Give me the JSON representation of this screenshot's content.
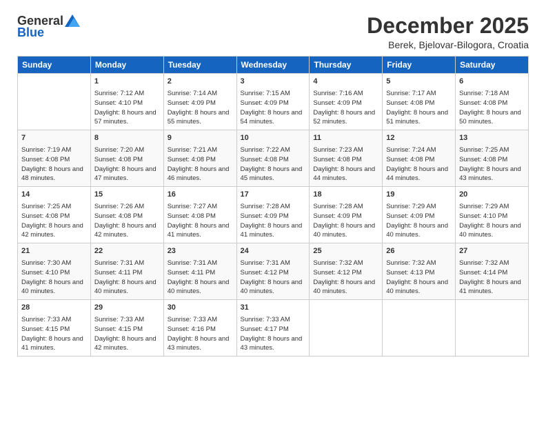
{
  "logo": {
    "general": "General",
    "blue": "Blue"
  },
  "title": "December 2025",
  "location": "Berek, Bjelovar-Bilogora, Croatia",
  "days_of_week": [
    "Sunday",
    "Monday",
    "Tuesday",
    "Wednesday",
    "Thursday",
    "Friday",
    "Saturday"
  ],
  "weeks": [
    [
      {
        "day": "",
        "sunrise": "",
        "sunset": "",
        "daylight": ""
      },
      {
        "day": "1",
        "sunrise": "Sunrise: 7:12 AM",
        "sunset": "Sunset: 4:10 PM",
        "daylight": "Daylight: 8 hours and 57 minutes."
      },
      {
        "day": "2",
        "sunrise": "Sunrise: 7:14 AM",
        "sunset": "Sunset: 4:09 PM",
        "daylight": "Daylight: 8 hours and 55 minutes."
      },
      {
        "day": "3",
        "sunrise": "Sunrise: 7:15 AM",
        "sunset": "Sunset: 4:09 PM",
        "daylight": "Daylight: 8 hours and 54 minutes."
      },
      {
        "day": "4",
        "sunrise": "Sunrise: 7:16 AM",
        "sunset": "Sunset: 4:09 PM",
        "daylight": "Daylight: 8 hours and 52 minutes."
      },
      {
        "day": "5",
        "sunrise": "Sunrise: 7:17 AM",
        "sunset": "Sunset: 4:08 PM",
        "daylight": "Daylight: 8 hours and 51 minutes."
      },
      {
        "day": "6",
        "sunrise": "Sunrise: 7:18 AM",
        "sunset": "Sunset: 4:08 PM",
        "daylight": "Daylight: 8 hours and 50 minutes."
      }
    ],
    [
      {
        "day": "7",
        "sunrise": "Sunrise: 7:19 AM",
        "sunset": "Sunset: 4:08 PM",
        "daylight": "Daylight: 8 hours and 48 minutes."
      },
      {
        "day": "8",
        "sunrise": "Sunrise: 7:20 AM",
        "sunset": "Sunset: 4:08 PM",
        "daylight": "Daylight: 8 hours and 47 minutes."
      },
      {
        "day": "9",
        "sunrise": "Sunrise: 7:21 AM",
        "sunset": "Sunset: 4:08 PM",
        "daylight": "Daylight: 8 hours and 46 minutes."
      },
      {
        "day": "10",
        "sunrise": "Sunrise: 7:22 AM",
        "sunset": "Sunset: 4:08 PM",
        "daylight": "Daylight: 8 hours and 45 minutes."
      },
      {
        "day": "11",
        "sunrise": "Sunrise: 7:23 AM",
        "sunset": "Sunset: 4:08 PM",
        "daylight": "Daylight: 8 hours and 44 minutes."
      },
      {
        "day": "12",
        "sunrise": "Sunrise: 7:24 AM",
        "sunset": "Sunset: 4:08 PM",
        "daylight": "Daylight: 8 hours and 44 minutes."
      },
      {
        "day": "13",
        "sunrise": "Sunrise: 7:25 AM",
        "sunset": "Sunset: 4:08 PM",
        "daylight": "Daylight: 8 hours and 43 minutes."
      }
    ],
    [
      {
        "day": "14",
        "sunrise": "Sunrise: 7:25 AM",
        "sunset": "Sunset: 4:08 PM",
        "daylight": "Daylight: 8 hours and 42 minutes."
      },
      {
        "day": "15",
        "sunrise": "Sunrise: 7:26 AM",
        "sunset": "Sunset: 4:08 PM",
        "daylight": "Daylight: 8 hours and 42 minutes."
      },
      {
        "day": "16",
        "sunrise": "Sunrise: 7:27 AM",
        "sunset": "Sunset: 4:08 PM",
        "daylight": "Daylight: 8 hours and 41 minutes."
      },
      {
        "day": "17",
        "sunrise": "Sunrise: 7:28 AM",
        "sunset": "Sunset: 4:09 PM",
        "daylight": "Daylight: 8 hours and 41 minutes."
      },
      {
        "day": "18",
        "sunrise": "Sunrise: 7:28 AM",
        "sunset": "Sunset: 4:09 PM",
        "daylight": "Daylight: 8 hours and 40 minutes."
      },
      {
        "day": "19",
        "sunrise": "Sunrise: 7:29 AM",
        "sunset": "Sunset: 4:09 PM",
        "daylight": "Daylight: 8 hours and 40 minutes."
      },
      {
        "day": "20",
        "sunrise": "Sunrise: 7:29 AM",
        "sunset": "Sunset: 4:10 PM",
        "daylight": "Daylight: 8 hours and 40 minutes."
      }
    ],
    [
      {
        "day": "21",
        "sunrise": "Sunrise: 7:30 AM",
        "sunset": "Sunset: 4:10 PM",
        "daylight": "Daylight: 8 hours and 40 minutes."
      },
      {
        "day": "22",
        "sunrise": "Sunrise: 7:31 AM",
        "sunset": "Sunset: 4:11 PM",
        "daylight": "Daylight: 8 hours and 40 minutes."
      },
      {
        "day": "23",
        "sunrise": "Sunrise: 7:31 AM",
        "sunset": "Sunset: 4:11 PM",
        "daylight": "Daylight: 8 hours and 40 minutes."
      },
      {
        "day": "24",
        "sunrise": "Sunrise: 7:31 AM",
        "sunset": "Sunset: 4:12 PM",
        "daylight": "Daylight: 8 hours and 40 minutes."
      },
      {
        "day": "25",
        "sunrise": "Sunrise: 7:32 AM",
        "sunset": "Sunset: 4:12 PM",
        "daylight": "Daylight: 8 hours and 40 minutes."
      },
      {
        "day": "26",
        "sunrise": "Sunrise: 7:32 AM",
        "sunset": "Sunset: 4:13 PM",
        "daylight": "Daylight: 8 hours and 40 minutes."
      },
      {
        "day": "27",
        "sunrise": "Sunrise: 7:32 AM",
        "sunset": "Sunset: 4:14 PM",
        "daylight": "Daylight: 8 hours and 41 minutes."
      }
    ],
    [
      {
        "day": "28",
        "sunrise": "Sunrise: 7:33 AM",
        "sunset": "Sunset: 4:15 PM",
        "daylight": "Daylight: 8 hours and 41 minutes."
      },
      {
        "day": "29",
        "sunrise": "Sunrise: 7:33 AM",
        "sunset": "Sunset: 4:15 PM",
        "daylight": "Daylight: 8 hours and 42 minutes."
      },
      {
        "day": "30",
        "sunrise": "Sunrise: 7:33 AM",
        "sunset": "Sunset: 4:16 PM",
        "daylight": "Daylight: 8 hours and 43 minutes."
      },
      {
        "day": "31",
        "sunrise": "Sunrise: 7:33 AM",
        "sunset": "Sunset: 4:17 PM",
        "daylight": "Daylight: 8 hours and 43 minutes."
      },
      {
        "day": "",
        "sunrise": "",
        "sunset": "",
        "daylight": ""
      },
      {
        "day": "",
        "sunrise": "",
        "sunset": "",
        "daylight": ""
      },
      {
        "day": "",
        "sunrise": "",
        "sunset": "",
        "daylight": ""
      }
    ]
  ]
}
